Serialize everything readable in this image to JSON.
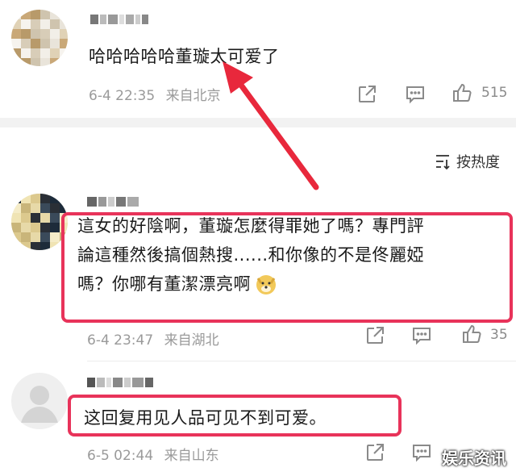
{
  "colors": {
    "highlight": "#e8335a",
    "arrow": "#e8283c",
    "meta_text": "#9a9a9a",
    "divider": "#f2f2f2"
  },
  "sort": {
    "label": "按热度",
    "icon": "sort-icon"
  },
  "comments": [
    {
      "text": "哈哈哈哈哈董璇太可爱了",
      "time": "6-4 22:35",
      "location": "来自北京",
      "likes": "515"
    },
    {
      "lines": [
        "這女的好陰啊，董璇怎麼得罪她了嗎？專門評",
        "論這種然後搞個熱搜......和你像的不是佟麗婭",
        "嗎？你哪有董潔漂亮啊"
      ],
      "emoji": "doge-emoji",
      "time": "6-4 23:47",
      "location": "来自湖北",
      "likes": "35"
    },
    {
      "text": "这回复用见人品可见不到可爱。",
      "time": "6-5 02:44",
      "location": "来自山东",
      "likes": ""
    }
  ],
  "icons": [
    "share-icon",
    "comment-icon",
    "like-icon"
  ],
  "watermark": "娱乐资讯"
}
